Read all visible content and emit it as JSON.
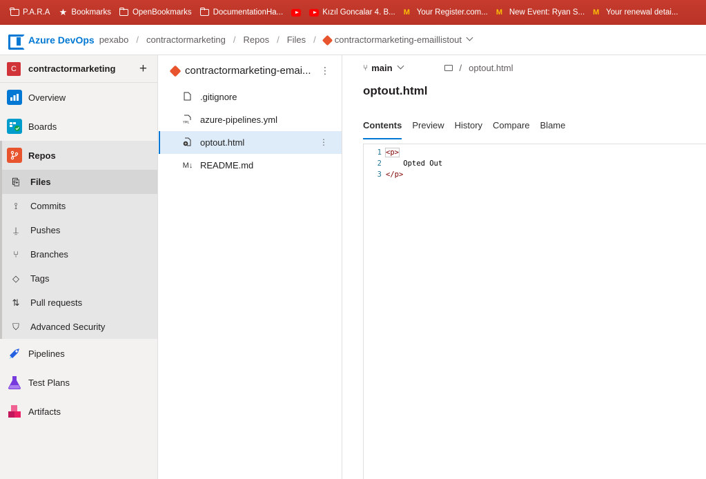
{
  "bookmarks": [
    {
      "label": "P.A.R.A",
      "icon": "folder-icon"
    },
    {
      "label": "Bookmarks",
      "icon": "star-icon"
    },
    {
      "label": "OpenBookmarks",
      "icon": "folder-icon"
    },
    {
      "label": "DocumentationHa...",
      "icon": "folder-icon"
    },
    {
      "label": "",
      "icon": "youtube-icon"
    },
    {
      "label": "Kızıl Goncalar 4. B...",
      "icon": "youtube-icon"
    },
    {
      "label": "Your Register.com...",
      "icon": "gmail-icon"
    },
    {
      "label": "New Event: Ryan S...",
      "icon": "gmail-icon"
    },
    {
      "label": "Your renewal detai...",
      "icon": "gmail-icon"
    }
  ],
  "header": {
    "brand": "Azure DevOps",
    "org": "pexabo",
    "project": "contractormarketing",
    "section": "Repos",
    "subsection": "Files",
    "repo": "contractormarketing-emaillistout"
  },
  "sidebar": {
    "project_initial": "C",
    "project_name": "contractormarketing",
    "add_label": "+",
    "items": [
      {
        "label": "Overview"
      },
      {
        "label": "Boards"
      },
      {
        "label": "Repos"
      },
      {
        "label": "Pipelines"
      },
      {
        "label": "Test Plans"
      },
      {
        "label": "Artifacts"
      }
    ],
    "repo_sub": [
      {
        "label": "Files",
        "glyph": "⎘"
      },
      {
        "label": "Commits",
        "glyph": "⟟"
      },
      {
        "label": "Pushes",
        "glyph": "⍊"
      },
      {
        "label": "Branches",
        "glyph": "⑂"
      },
      {
        "label": "Tags",
        "glyph": "◇"
      },
      {
        "label": "Pull requests",
        "glyph": "⇅"
      },
      {
        "label": "Advanced Security",
        "glyph": "⛉"
      }
    ]
  },
  "tree": {
    "title": "contractormarketing-emai...",
    "files": [
      {
        "name": ".gitignore",
        "glyph": "🗋"
      },
      {
        "name": "azure-pipelines.yml",
        "glyph": "⎙"
      },
      {
        "name": "optout.html",
        "glyph": "⎗"
      },
      {
        "name": "README.md",
        "glyph": "M↓"
      }
    ]
  },
  "main": {
    "branch": "main",
    "path": "optout.html",
    "path_sep": "/",
    "file_title": "optout.html",
    "tabs": [
      "Contents",
      "Preview",
      "History",
      "Compare",
      "Blame"
    ],
    "code": [
      {
        "n": "1",
        "text": "<p>"
      },
      {
        "n": "2",
        "text": "    Opted Out"
      },
      {
        "n": "3",
        "text": "</p>"
      }
    ]
  },
  "colors": {
    "accent": "#0078d4",
    "bookmark_bar": "#c0392b",
    "project_avatar": "#d13438",
    "git": "#e8542d"
  }
}
